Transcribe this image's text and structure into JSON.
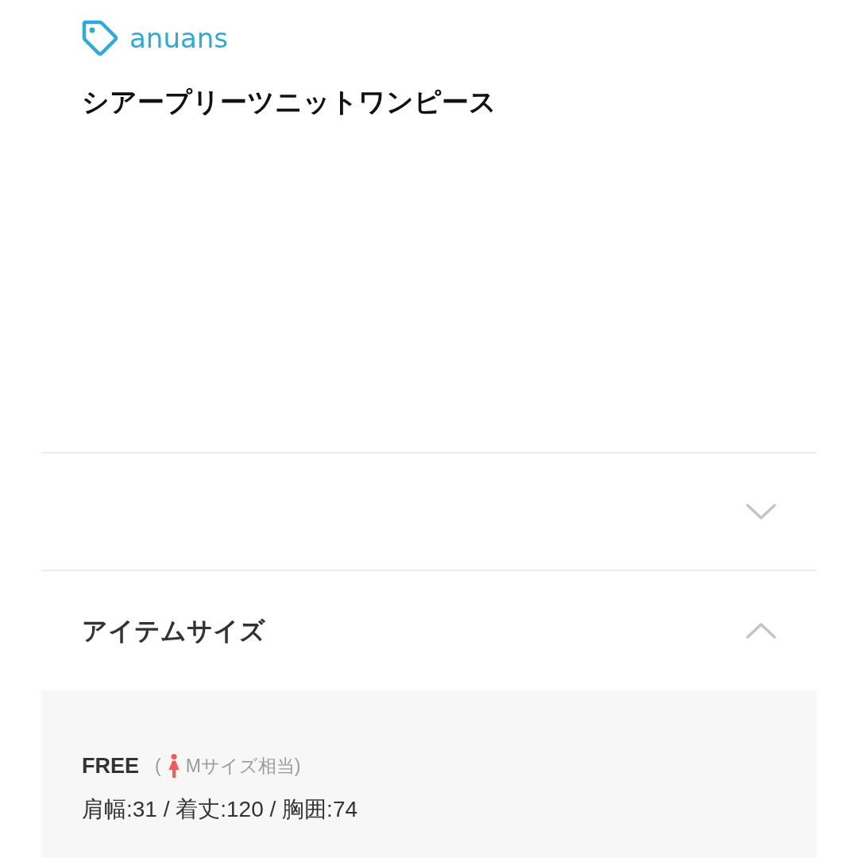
{
  "brand": {
    "name": "anuans"
  },
  "product": {
    "title": "シアープリーツニットワンピース"
  },
  "sections": [
    {
      "expanded": false
    },
    {
      "title": "アイテムサイズ",
      "expanded": true,
      "sizes": [
        {
          "name": "FREE",
          "open_paren": "(",
          "equivalent": "Mサイズ相当)",
          "measurements": "肩幅:31 / 着丈:120 / 胸囲:74"
        }
      ]
    }
  ]
}
